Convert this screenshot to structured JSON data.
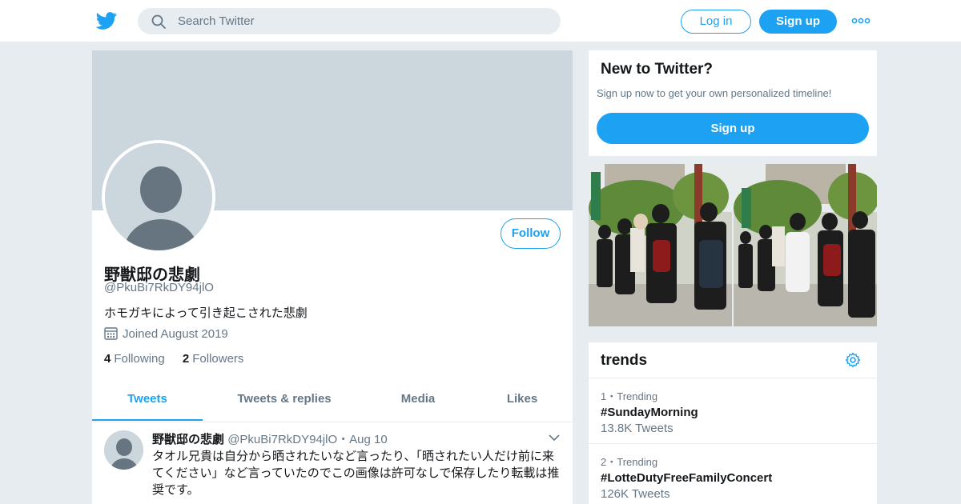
{
  "colors": {
    "accent": "#1da1f2",
    "background": "#e6ecf0",
    "muted": "#657786",
    "banner": "#ccd6dd"
  },
  "header": {
    "logo_icon": "twitter-bird-icon",
    "search_placeholder": "Search Twitter",
    "login_label": "Log in",
    "signup_label": "Sign up",
    "more_icon": "more-dots-icon"
  },
  "profile": {
    "follow_label": "Follow",
    "name": "野獣邸の悲劇",
    "handle": "@PkuBi7RkDY94jlO",
    "bio": "ホモガキによって引き起こされた悲劇",
    "joined": "Joined August 2019",
    "following_count": "4",
    "following_label": "Following",
    "followers_count": "2",
    "followers_label": "Followers",
    "tabs": [
      "Tweets",
      "Tweets & replies",
      "Media",
      "Likes"
    ]
  },
  "tweet": {
    "name": "野獣邸の悲劇",
    "handle_date": "@PkuBi7RkDY94jlO・Aug 10",
    "text": "タオル兄貴は自分から晒されたいなど言ったり、「晒されたい人だけ前に来てください」など言っていたのでこの画像は許可なしで保存したり転載は推奨です。"
  },
  "new_to_twitter": {
    "title": "New to Twitter?",
    "subtitle": "Sign up now to get your own personalized timeline!",
    "button": "Sign up"
  },
  "trends": {
    "title": "trends",
    "items": [
      {
        "meta": "1・Trending",
        "tag": "#SundayMorning",
        "count": "13.8K Tweets"
      },
      {
        "meta": "2・Trending",
        "tag": "#LotteDutyFreeFamilyConcert",
        "count": "126K Tweets"
      }
    ]
  }
}
